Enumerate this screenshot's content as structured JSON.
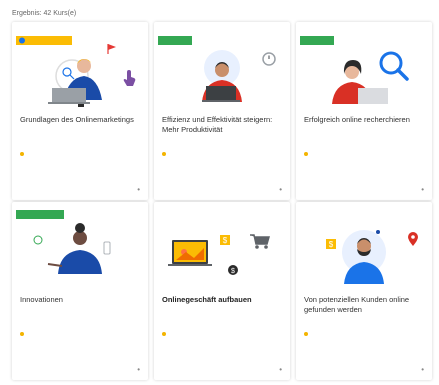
{
  "page": {
    "results_label": "Ergebnis: 42 Kurs(e)"
  },
  "colors": {
    "accent_blue": "#1a73e8",
    "badge_green": "#34a853",
    "badge_yellow": "#fbbc04",
    "rating": "#f4b400"
  },
  "courses": [
    {
      "title": "Grundlagen des Onlinemarketings",
      "badge": "",
      "meta": "",
      "more": "•"
    },
    {
      "title": "Effizienz und Effektivität steigern: Mehr Produktivität",
      "badge": "",
      "meta": "",
      "more": "•"
    },
    {
      "title": "Erfolgreich online recherchieren",
      "badge": "",
      "meta": "",
      "more": "•"
    },
    {
      "title": "Innovationen",
      "badge": "",
      "meta": "",
      "more": "•"
    },
    {
      "title": "Onlinegeschäft aufbauen",
      "badge": "",
      "meta": "",
      "more": "•"
    },
    {
      "title": "Von potenziellen Kunden online gefunden werden",
      "badge": "",
      "meta": "",
      "more": "•"
    }
  ],
  "icons": [
    "play-icon",
    "touch-icon",
    "timer-icon",
    "search-icon",
    "cart-icon",
    "dollar-icon",
    "map-pin-icon",
    "three-dots-icon"
  ]
}
